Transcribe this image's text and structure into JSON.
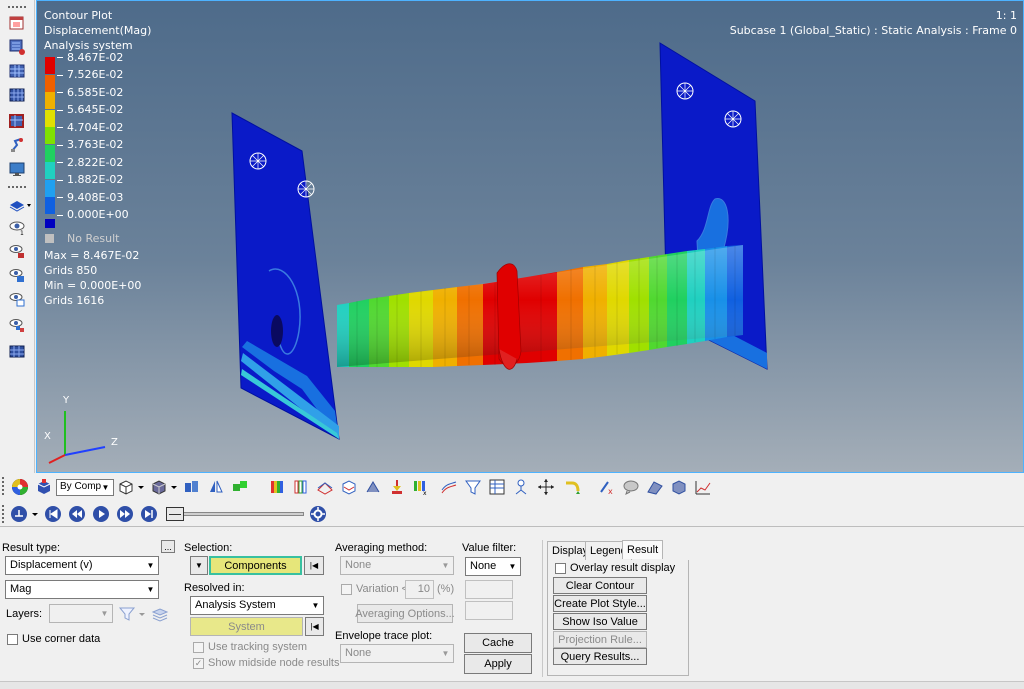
{
  "viewport": {
    "plot_type": "Contour Plot",
    "result_label": "Displacement(Mag)",
    "system_label": "Analysis system",
    "page_ratio": "1: 1",
    "subcase": "Subcase 1 (Global_Static) : Static Analysis : Frame 0",
    "legend": {
      "values": [
        "8.467E-02",
        "7.526E-02",
        "6.585E-02",
        "5.645E-02",
        "4.704E-02",
        "3.763E-02",
        "2.822E-02",
        "1.882E-02",
        "9.408E-03",
        "0.000E+00"
      ],
      "colors": [
        "#e00000",
        "#f06000",
        "#f0b000",
        "#e0e000",
        "#80e000",
        "#20d060",
        "#20d0c0",
        "#20a0f0",
        "#1060e0",
        "#0000c0"
      ],
      "no_result_label": "No Result",
      "no_result_color": "#c0c0c0",
      "max_text": "Max = 8.467E-02",
      "max_grid": "Grids 850",
      "min_text": "Min = 0.000E+00",
      "min_grid": "Grids 1616"
    },
    "triad": {
      "y": "Y",
      "x": "X",
      "z": "Z"
    }
  },
  "toolbar": {
    "by_comp_label": "By Comp"
  },
  "panel": {
    "result_type_label": "Result type:",
    "result_type_value": "Displacement (v)",
    "ellipsis_label": "...",
    "component_value": "Mag",
    "layers_label": "Layers:",
    "use_corner_data_label": "Use corner data",
    "selection_label": "Selection:",
    "components_button": "Components",
    "resolved_in_label": "Resolved in:",
    "resolved_value": "Analysis System",
    "system_button": "System",
    "use_tracking_label": "Use tracking system",
    "show_midside_label": "Show midside node results",
    "averaging_label": "Averaging method:",
    "averaging_value": "None",
    "variation_label": "Variation <",
    "variation_value": "10",
    "variation_unit": "(%)",
    "averaging_options_button": "Averaging Options...",
    "envelope_label": "Envelope trace plot:",
    "envelope_value": "None",
    "value_filter_label": "Value filter:",
    "value_filter_value": "None",
    "cache_button": "Cache",
    "apply_button": "Apply",
    "tabs": [
      "Display",
      "Legend",
      "Result"
    ],
    "overlay_label": "Overlay result display",
    "clear_contour_button": "Clear Contour",
    "create_plot_style_button": "Create Plot Style...",
    "show_iso_value_button": "Show Iso Value",
    "projection_rule_button": "Projection Rule...",
    "query_results_button": "Query Results..."
  }
}
